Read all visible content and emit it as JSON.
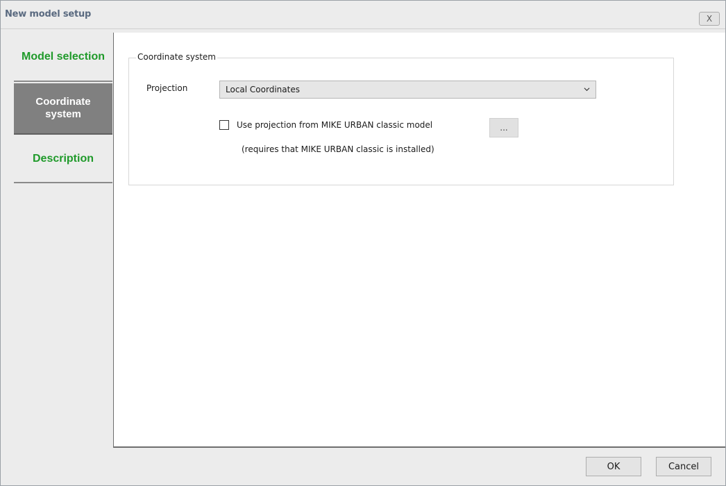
{
  "window": {
    "title": "New model setup",
    "close_glyph": "X"
  },
  "nav": {
    "items": [
      {
        "label": "Model selection",
        "state": "link"
      },
      {
        "label": "Coordinate system",
        "state": "active"
      },
      {
        "label": "Description",
        "state": "link"
      }
    ]
  },
  "coordinate_system": {
    "group_title": "Coordinate system",
    "projection_label": "Projection",
    "projection_value": "Local Coordinates",
    "use_projection_label": "Use projection from MIKE URBAN classic model",
    "use_projection_checked": false,
    "browse_label": "...",
    "note": "(requires that MIKE URBAN classic is installed)"
  },
  "footer": {
    "ok_label": "OK",
    "cancel_label": "Cancel"
  },
  "colors": {
    "nav_link": "#1f9a2a",
    "nav_active_bg": "#808080"
  }
}
